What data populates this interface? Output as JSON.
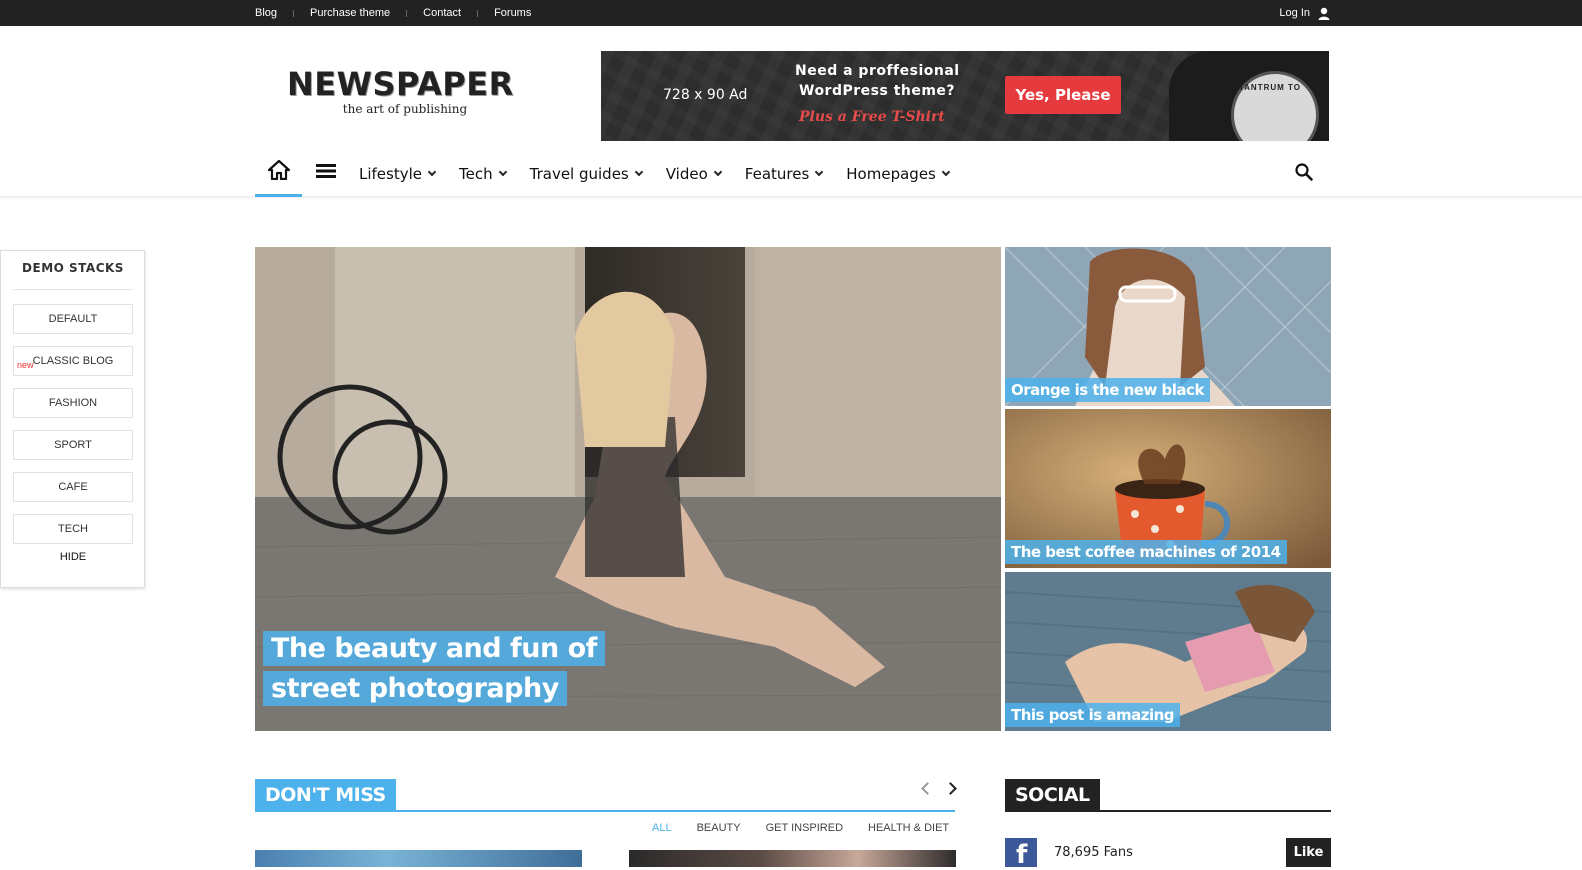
{
  "topbar": {
    "links": [
      "Blog",
      "Purchase theme",
      "Contact",
      "Forums"
    ],
    "login_label": "Log In"
  },
  "logo": {
    "title": "NEWSPAPER",
    "tagline": "the art of publishing"
  },
  "ad": {
    "size_label": "728 x 90 Ad",
    "line1": "Need a proffesional",
    "line2": "WordPress theme?",
    "line3": "Plus a Free T-Shirt",
    "button_label": "Yes, Please",
    "shirt_text": "TANTRUM TO"
  },
  "nav": {
    "items": [
      "Lifestyle",
      "Tech",
      "Travel guides",
      "Video",
      "Features",
      "Homepages"
    ]
  },
  "demo": {
    "title": "DEMO STACKS",
    "new_badge": "new",
    "buttons": [
      "DEFAULT",
      "CLASSIC BLOG",
      "FASHION",
      "SPORT",
      "CAFE",
      "TECH"
    ],
    "hide_label": "HIDE"
  },
  "hero": {
    "main_title": "The beauty and fun of street photography",
    "side_titles": [
      "Orange is the new black",
      "The best coffee machines of 2014",
      "This post is amazing"
    ]
  },
  "dont_miss": {
    "label": "DON'T MISS",
    "filters": [
      "ALL",
      "BEAUTY",
      "GET INSPIRED",
      "HEALTH & DIET"
    ]
  },
  "social": {
    "label": "SOCIAL",
    "fb_letter": "f",
    "fb_count": "78,695",
    "fb_unit": "Fans",
    "like_label": "Like"
  },
  "colors": {
    "accent": "#4db2ec",
    "topbar": "#222222",
    "ad_button": "#e63b3e",
    "facebook": "#3b5998"
  }
}
